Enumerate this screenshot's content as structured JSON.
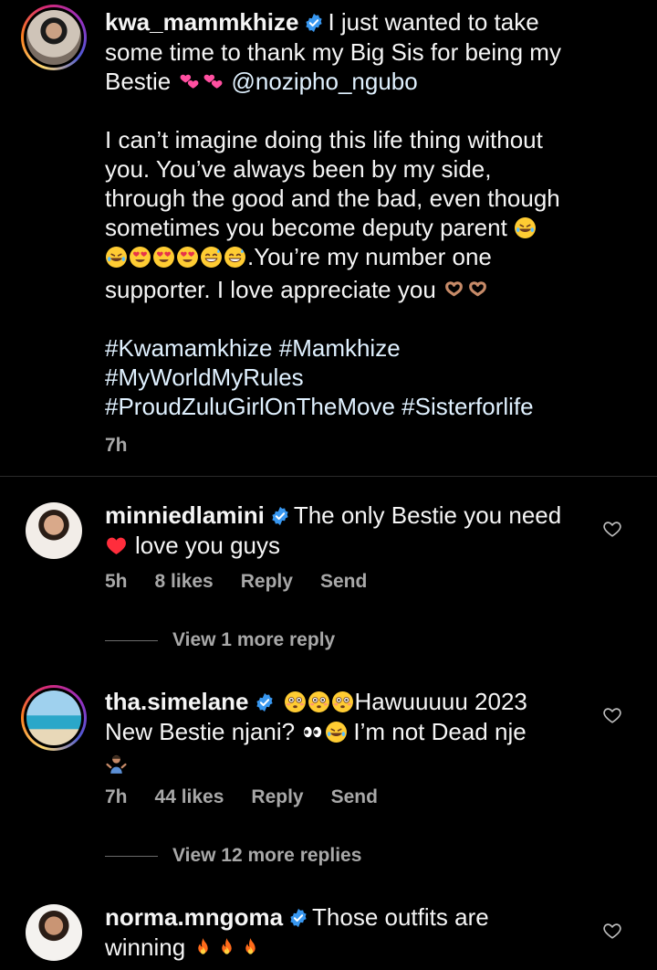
{
  "post": {
    "username": "kwa_mammkhize",
    "line1": "I just wanted to take",
    "line2": "some time to thank my Big Sis for being my",
    "line3_word": "Bestie",
    "mention": "@nozipho_ngubo",
    "para2_l1": "I can’t imagine doing this life thing without",
    "para2_l2": "you. You’ve always been by my side,",
    "para2_l3": "through the good and the bad, even though",
    "para2_l4": "sometimes you become deputy parent",
    "para2_l5": ".You’re my number one",
    "para2_l6": "supporter. I love appreciate you",
    "hashtags_l1": "#Kwamamkhize #Mamkhize",
    "hashtags_l2": "#MyWorldMyRules",
    "hashtags_l3": "#ProudZuluGirlOnTheMove #Sisterforlife",
    "time": "7h"
  },
  "comments": [
    {
      "username": "minniedlamini",
      "text_l1": "The only Bestie you need",
      "text_l2": "love you guys",
      "time": "5h",
      "likes": "8 likes",
      "reply": "Reply",
      "send": "Send",
      "view_more": "View 1 more reply"
    },
    {
      "username": "tha.simelane",
      "text_l1": "Hawuuuuu 2023",
      "text_l2a": "New Bestie njani?",
      "text_l2b": "I’m not Dead nje",
      "time": "7h",
      "likes": "44 likes",
      "reply": "Reply",
      "send": "Send",
      "view_more": "View 12 more replies"
    },
    {
      "username": "norma.mngoma",
      "text_l1": "Those outfits are",
      "text_l2": "winning"
    }
  ],
  "icons": {
    "verified": "verified-badge-icon",
    "heart": "heart-outline-icon"
  },
  "colors": {
    "background": "#000000",
    "text": "#f5f5f5",
    "muted": "#a8a8a8",
    "verified": "#3897f0"
  }
}
